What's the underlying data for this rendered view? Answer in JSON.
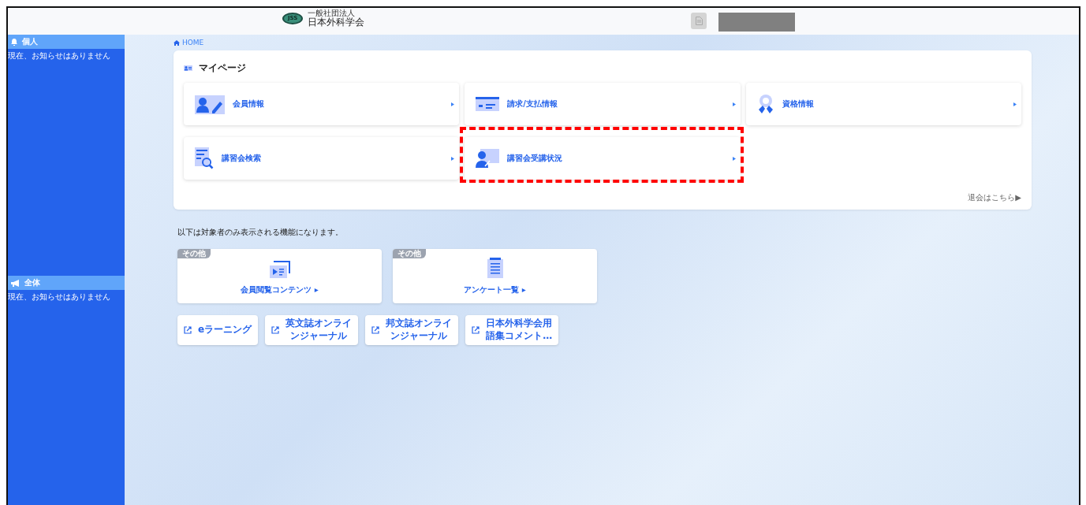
{
  "header": {
    "logo_mark": "JSS",
    "logo_subtitle": "一般社団法人",
    "logo_title": "日本外科学会"
  },
  "sidebar": {
    "sections": [
      {
        "kind": "personal",
        "title": "個人",
        "message": "現在、お知らせはありません"
      },
      {
        "kind": "all",
        "title": "全体",
        "message": "現在、お知らせはありません"
      }
    ]
  },
  "breadcrumb": "HOME",
  "mypage": {
    "title": "マイページ",
    "tiles": [
      {
        "kind": "member",
        "label": "会員情報",
        "highlighted": false
      },
      {
        "kind": "billing",
        "label": "請求/支払情報",
        "highlighted": false
      },
      {
        "kind": "qualification",
        "label": "資格情報",
        "highlighted": false
      },
      {
        "kind": "search",
        "label": "講習会検索",
        "highlighted": false
      },
      {
        "kind": "attendance",
        "label": "講習会受講状況",
        "highlighted": true
      }
    ],
    "withdraw_link": "退会はこちら▶"
  },
  "notice": "以下は対象者のみ表示される機能になります。",
  "feature_cards": [
    {
      "kind": "contents",
      "tag": "その他",
      "label": "会員閲覧コンテンツ ▸"
    },
    {
      "kind": "survey",
      "tag": "その他",
      "label": "アンケート一覧 ▸"
    }
  ],
  "external_links": [
    {
      "lines": [
        "eラーニング"
      ]
    },
    {
      "lines": [
        "英文誌オンライ",
        "ンジャーナル"
      ]
    },
    {
      "lines": [
        "邦文誌オンライ",
        "ンジャーナル"
      ]
    },
    {
      "lines": [
        "日本外科学会用",
        "語集コメント…"
      ]
    }
  ]
}
